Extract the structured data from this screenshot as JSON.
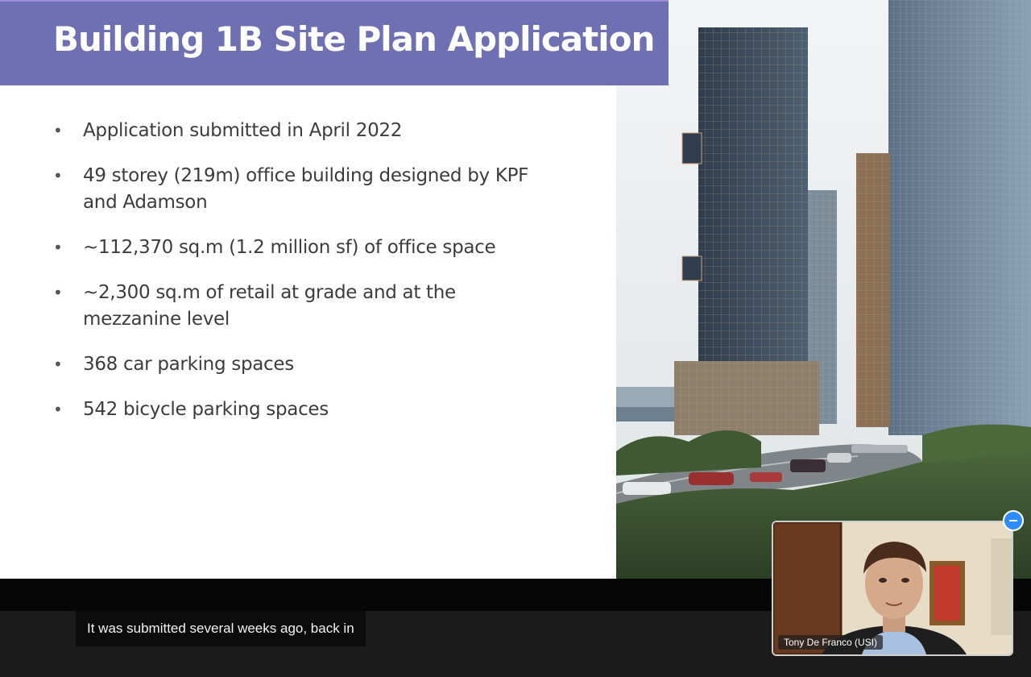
{
  "slide": {
    "title": "Building 1B Site Plan Application",
    "bullets": [
      "Application submitted in April 2022",
      "49 storey (219m) office building designed by KPF and Adamson",
      "~112,370 sq.m (1.2 million sf) of office space",
      "~2,300 sq.m of retail at grade and at the mezzanine level",
      "368 car parking spaces",
      "542 bicycle parking spaces"
    ],
    "bullet_glyph": "•"
  },
  "caption": {
    "text": "It was submitted several weeks ago, back in"
  },
  "video": {
    "participant_name": "Tony De Franco (USI)",
    "minimize_icon": "minus-icon"
  },
  "colors": {
    "title_bar": "#6f6fb4",
    "minimize_button": "#2d8cff"
  }
}
